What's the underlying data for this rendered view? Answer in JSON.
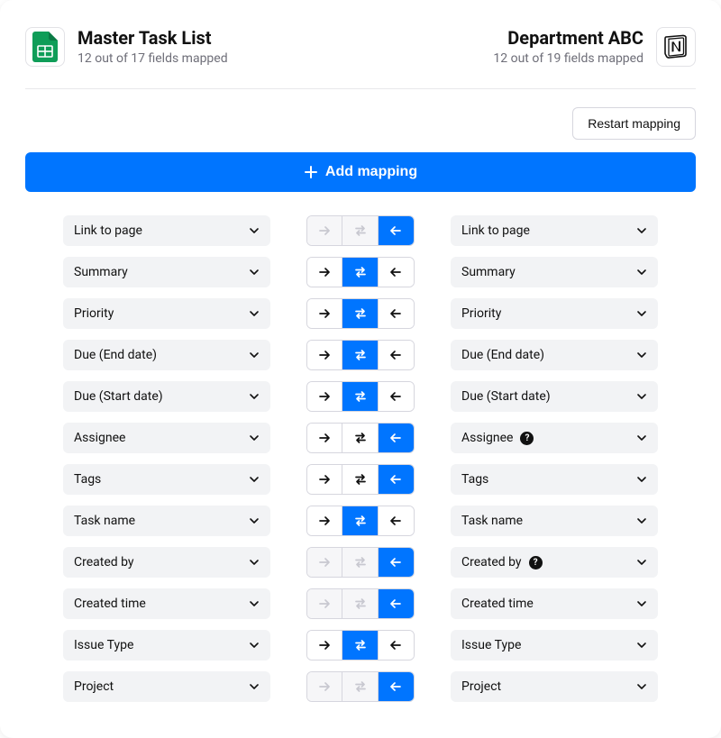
{
  "colors": {
    "primary": "#0075ff",
    "google_green": "#0f9d58"
  },
  "left_source": {
    "title": "Master Task List",
    "sub": "12 out of 17 fields mapped",
    "app": "google-sheets"
  },
  "right_source": {
    "title": "Department ABC",
    "sub": "12 out of 19 fields mapped",
    "app": "notion"
  },
  "restart_label": "Restart mapping",
  "add_label": "Add mapping",
  "mappings": [
    {
      "left": "Link to page",
      "right": "Link to page",
      "states": [
        "disabled",
        "disabled",
        "active"
      ],
      "right_help": false
    },
    {
      "left": "Summary",
      "right": "Summary",
      "states": [
        "normal",
        "active",
        "normal"
      ],
      "right_help": false
    },
    {
      "left": "Priority",
      "right": "Priority",
      "states": [
        "normal",
        "active",
        "normal"
      ],
      "right_help": false
    },
    {
      "left": "Due (End date)",
      "right": "Due (End date)",
      "states": [
        "normal",
        "active",
        "normal"
      ],
      "right_help": false
    },
    {
      "left": "Due (Start date)",
      "right": "Due (Start date)",
      "states": [
        "normal",
        "active",
        "normal"
      ],
      "right_help": false
    },
    {
      "left": "Assignee",
      "right": "Assignee",
      "states": [
        "normal",
        "normal",
        "active"
      ],
      "right_help": true
    },
    {
      "left": "Tags",
      "right": "Tags",
      "states": [
        "normal",
        "normal",
        "active"
      ],
      "right_help": false
    },
    {
      "left": "Task name",
      "right": "Task name",
      "states": [
        "normal",
        "active",
        "normal"
      ],
      "right_help": false
    },
    {
      "left": "Created by",
      "right": "Created by",
      "states": [
        "disabled",
        "disabled",
        "active"
      ],
      "right_help": true
    },
    {
      "left": "Created time",
      "right": "Created time",
      "states": [
        "disabled",
        "disabled",
        "active"
      ],
      "right_help": false
    },
    {
      "left": "Issue Type",
      "right": "Issue Type",
      "states": [
        "normal",
        "active",
        "normal"
      ],
      "right_help": false
    },
    {
      "left": "Project",
      "right": "Project",
      "states": [
        "disabled",
        "disabled",
        "active"
      ],
      "right_help": false
    }
  ]
}
